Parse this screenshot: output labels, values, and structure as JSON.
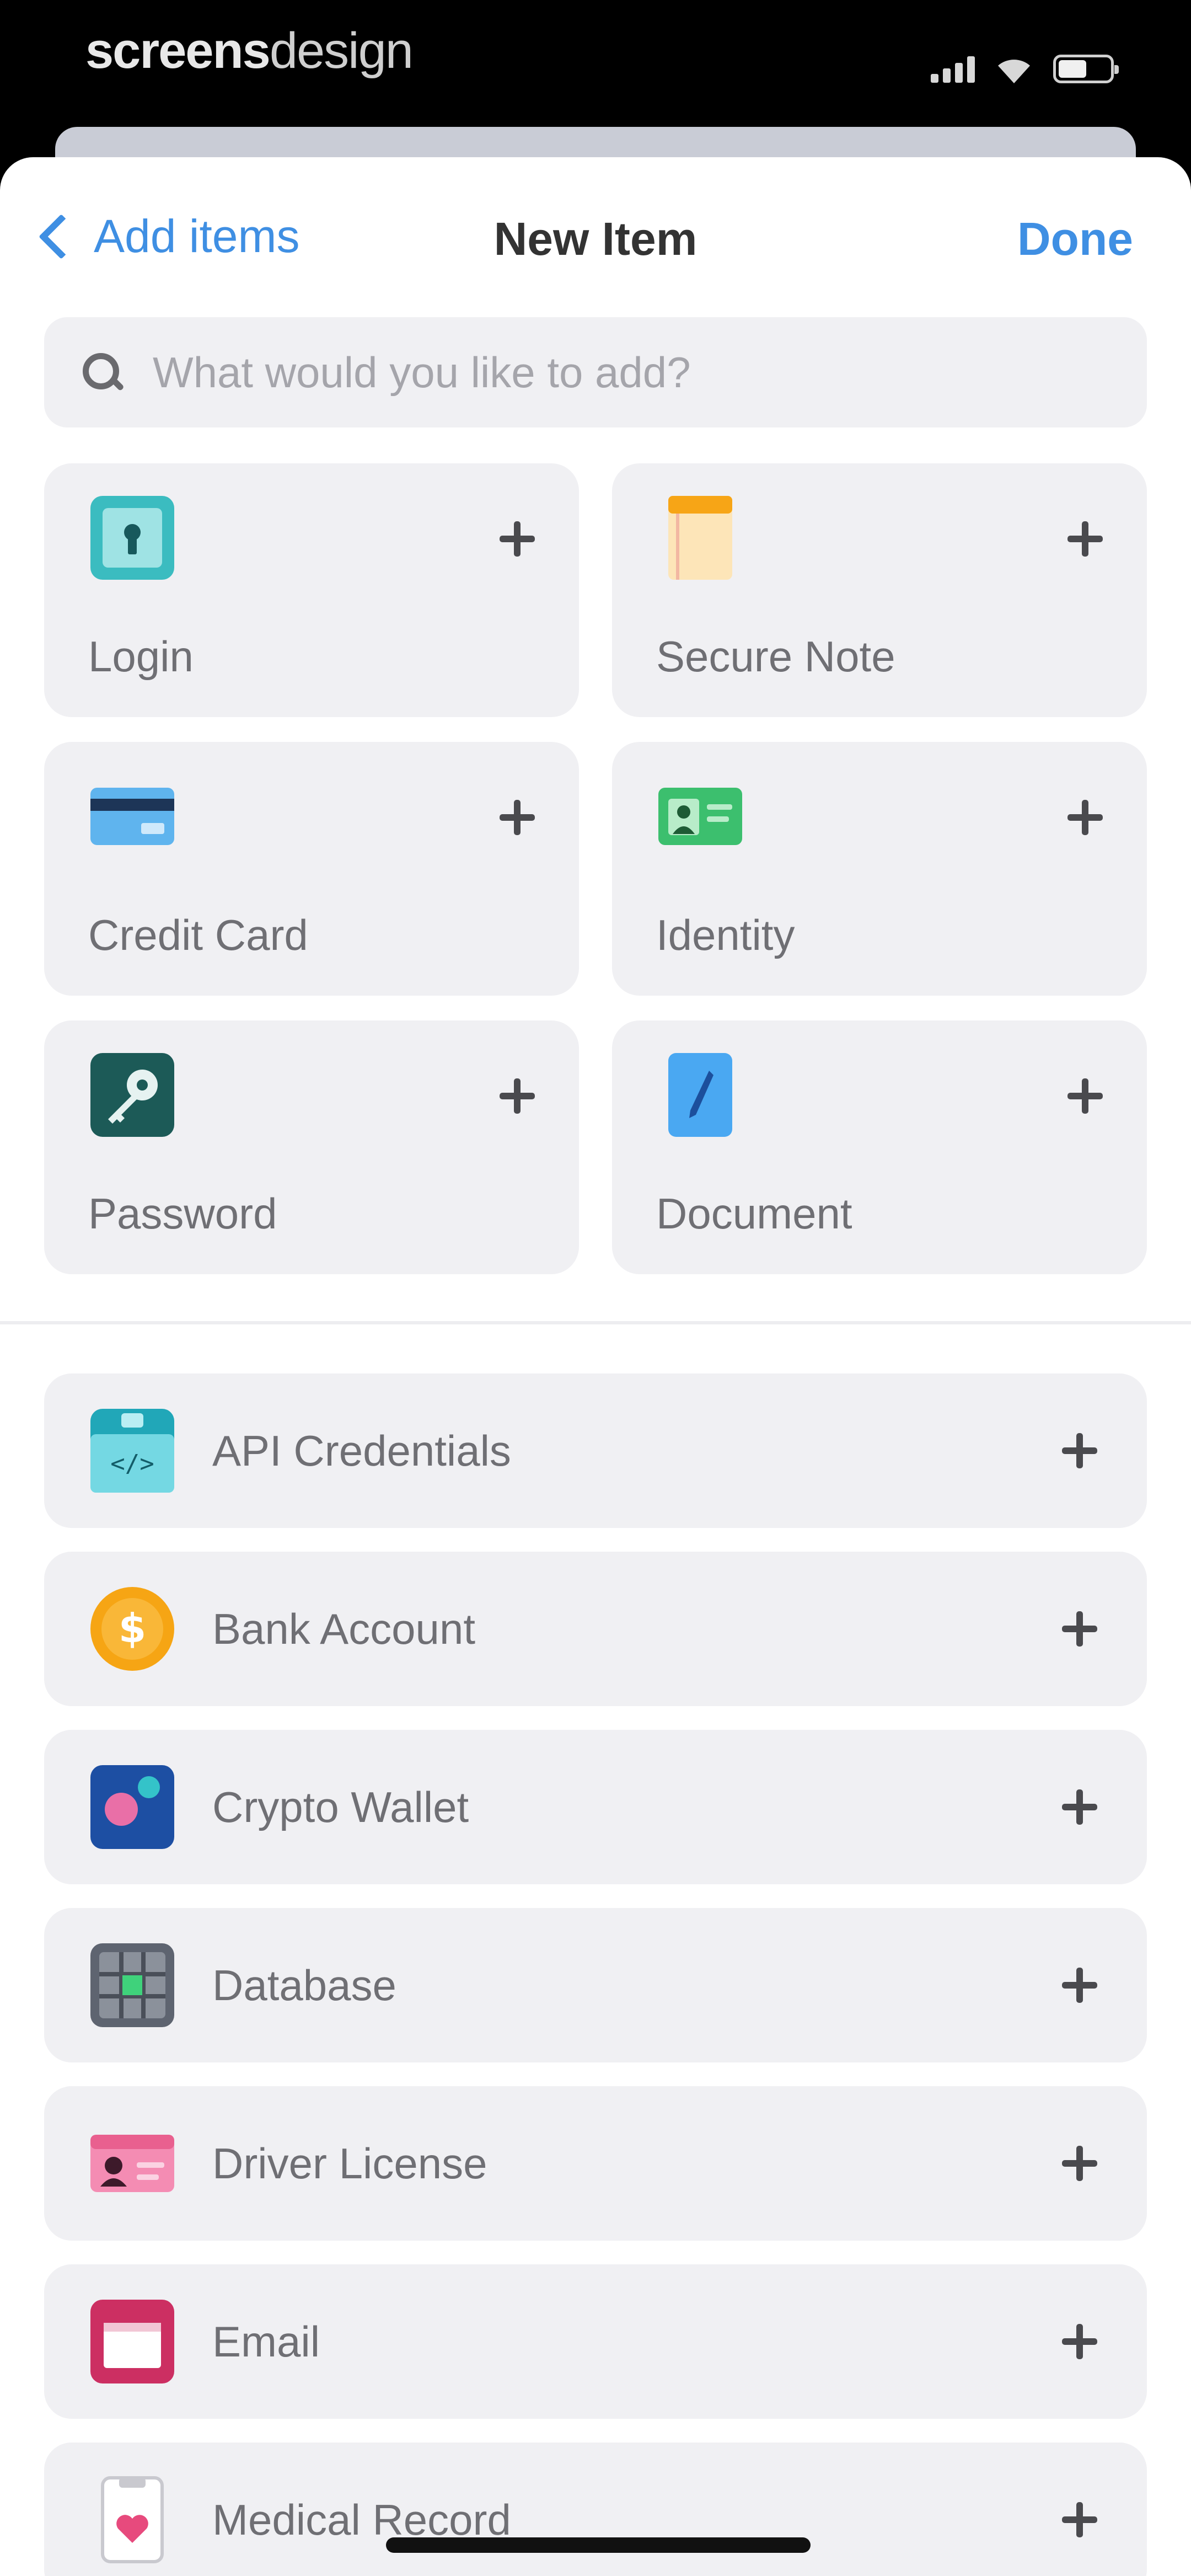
{
  "status_bar": {
    "watermark_bold": "screens",
    "watermark_light": "design"
  },
  "nav": {
    "back_label": "Add items",
    "title": "New Item",
    "done_label": "Done"
  },
  "search": {
    "placeholder": "What would you like to add?",
    "value": ""
  },
  "tiles": [
    {
      "label": "Login",
      "icon": "login-icon"
    },
    {
      "label": "Secure Note",
      "icon": "secure-note-icon"
    },
    {
      "label": "Credit Card",
      "icon": "credit-card-icon"
    },
    {
      "label": "Identity",
      "icon": "identity-icon"
    },
    {
      "label": "Password",
      "icon": "password-icon"
    },
    {
      "label": "Document",
      "icon": "document-icon"
    }
  ],
  "list": [
    {
      "label": "API Credentials",
      "icon": "api-credentials-icon"
    },
    {
      "label": "Bank Account",
      "icon": "bank-account-icon"
    },
    {
      "label": "Crypto Wallet",
      "icon": "crypto-wallet-icon"
    },
    {
      "label": "Database",
      "icon": "database-icon"
    },
    {
      "label": "Driver License",
      "icon": "driver-license-icon"
    },
    {
      "label": "Email",
      "icon": "email-icon"
    },
    {
      "label": "Medical Record",
      "icon": "medical-record-icon"
    }
  ],
  "colors": {
    "accent": "#3f8fe3",
    "card_bg": "#f0f0f3",
    "label": "#6f6f74"
  }
}
